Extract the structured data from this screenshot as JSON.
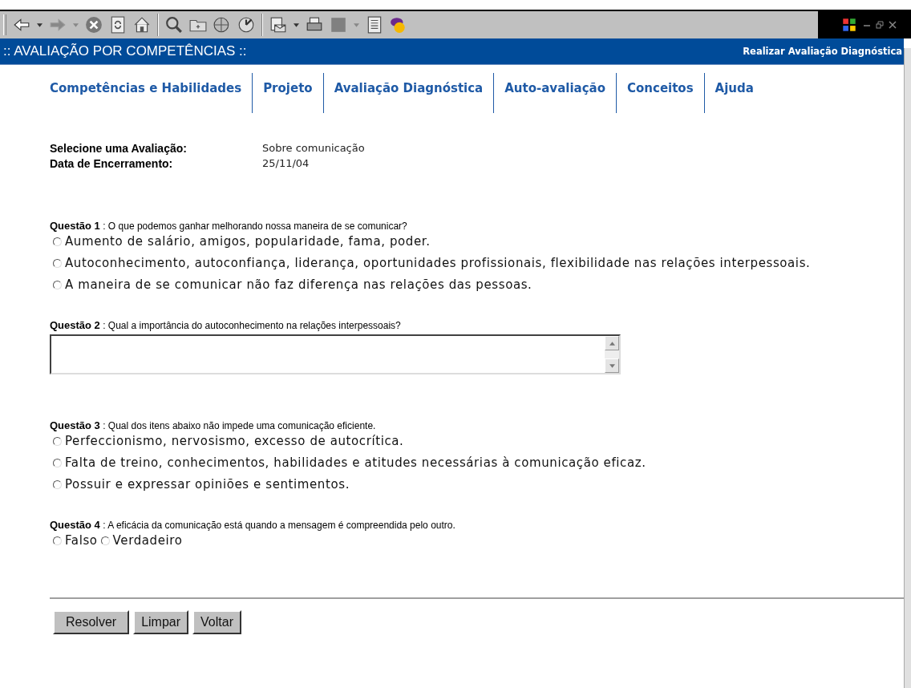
{
  "header": {
    "title": ":: AVALIAÇÃO POR COMPETÊNCIAS ::",
    "page_title": "Realizar Avaliação Diagnóstica"
  },
  "nav": [
    {
      "label": "Competências e Habilidades"
    },
    {
      "label": "Projeto"
    },
    {
      "label": "Avaliação Diagnóstica"
    },
    {
      "label": "Auto-avaliação"
    },
    {
      "label": "Conceitos"
    },
    {
      "label": "Ajuda"
    }
  ],
  "info": [
    {
      "label": "Selecione uma Avaliação:",
      "value": "Sobre comunicação"
    },
    {
      "label": "Data de Encerramento:",
      "value": "25/11/04"
    }
  ],
  "questions": [
    {
      "kind": "choice",
      "label": "Questão 1",
      "separator": ":",
      "text": "O que podemos ganhar melhorando nossa maneira de se comunicar?",
      "options": [
        {
          "label": "Aumento de salário, amigos, popularidade, fama, poder.",
          "selected": false
        },
        {
          "label": "Autoconhecimento, autoconfiança, liderança, oportunidades profissionais, flexibilidade nas relações interpessoais.",
          "selected": false
        },
        {
          "label": "A maneira de se comunicar não faz diferença nas relações das pessoas.",
          "selected": false
        }
      ]
    },
    {
      "kind": "text",
      "label": "Questão 2",
      "separator": ":",
      "text": "Qual a importância do autoconhecimento na relações interpessoais?"
    },
    {
      "kind": "choice",
      "label": "Questão 3",
      "separator": ":",
      "text": "Qual dos itens abaixo não impede uma comunicação eficiente.",
      "options": [
        {
          "label": "Perfeccionismo, nervosismo, excesso de autocrítica.",
          "selected": false
        },
        {
          "label": "Falta de treino, conhecimentos, habilidades e atitudes necessárias à comunicação eficaz.",
          "selected": false
        },
        {
          "label": "Possuir e expressar opiniões e sentimentos.",
          "selected": false
        }
      ]
    },
    {
      "kind": "inline_choice",
      "label": "Questão 4",
      "separator": ":",
      "text": "A eficácia da comunicação está quando a mensagem é compreendida pelo outro.",
      "options": [
        {
          "label": "Falso",
          "selected": false
        },
        {
          "label": "Verdadeiro",
          "selected": false
        }
      ]
    }
  ],
  "buttons": [
    "Resolver",
    "Limpar",
    "Voltar"
  ]
}
